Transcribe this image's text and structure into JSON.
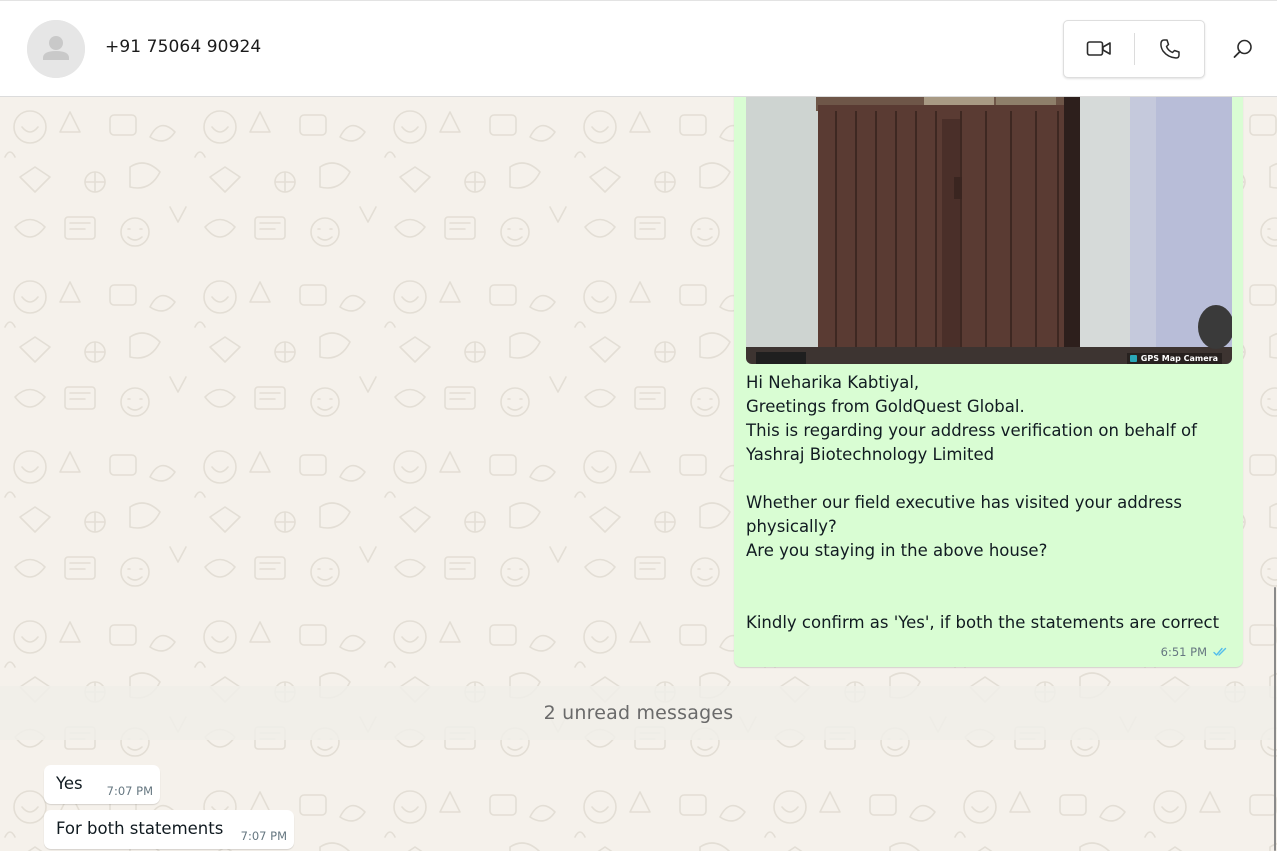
{
  "header": {
    "contact_name": "+91 75064 90924"
  },
  "icons": {
    "avatar": "default-user-avatar",
    "video_call": "video-camera-icon",
    "voice_call": "phone-icon",
    "search": "search-icon",
    "read_receipt": "double-check-icon"
  },
  "colors": {
    "outgoing_bubble": "#d9fdd3",
    "incoming_bubble": "#ffffff",
    "read_ticks": "#53bdeb",
    "chat_background": "#f5f1eb"
  },
  "outgoing_message": {
    "image_watermark": "GPS Map Camera",
    "lines": [
      "Hi Neharika Kabtiyal,",
      "Greetings from GoldQuest Global.",
      "This is regarding your address verification on behalf of",
      "Yashraj Biotechnology Limited",
      "",
      "Whether our field executive has visited your address",
      "physically?",
      "Are you staying in the above house?",
      "",
      "",
      "Kindly confirm as 'Yes', if both the statements are correct"
    ],
    "time": "6:51 PM"
  },
  "unread_divider": {
    "text": "2 unread messages"
  },
  "incoming_messages": [
    {
      "text": "Yes",
      "time": "7:07 PM"
    },
    {
      "text": "For both statements",
      "time": "7:07 PM"
    }
  ]
}
